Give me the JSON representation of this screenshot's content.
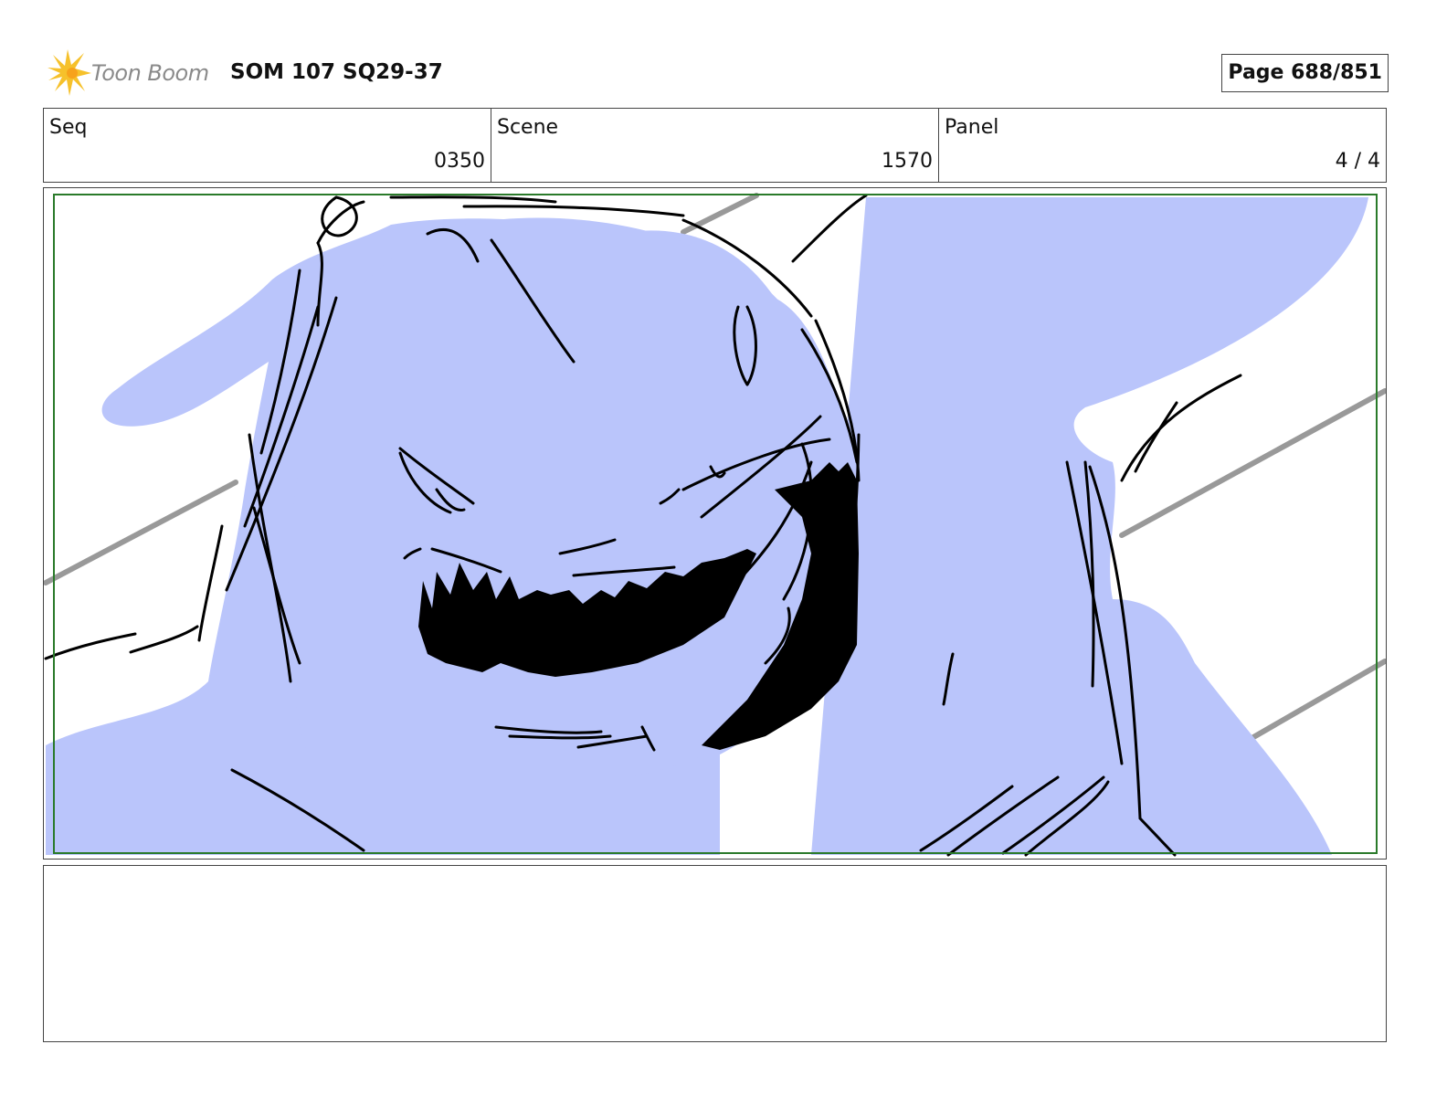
{
  "header": {
    "logo_text": "Toon Boom",
    "logo_icon": "starburst-icon",
    "title": "SOM 107 SQ29-37",
    "page_label": "Page 688/851"
  },
  "info": {
    "seq_label": "Seq",
    "seq_value": "0350",
    "scene_label": "Scene",
    "scene_value": "1570",
    "panel_label": "Panel",
    "panel_value": "4 / 4"
  },
  "panel": {
    "fill_color": "#bac5fb",
    "line_color": "#000000",
    "guide_line_color": "#999999",
    "safe_frame_color": "#2a7a2a"
  },
  "notes": {
    "text": ""
  }
}
